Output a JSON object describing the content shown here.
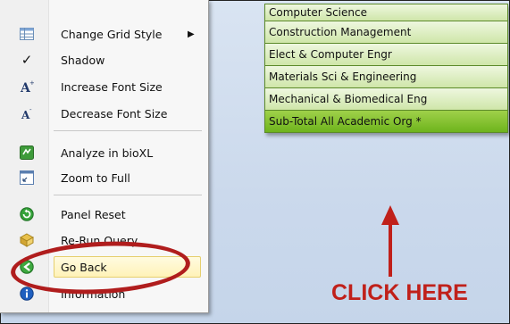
{
  "menu": {
    "items": [
      {
        "label": "Change Grid Style",
        "icon": "grid-style-icon",
        "has_submenu": true
      },
      {
        "label": "Shadow",
        "icon": "checkmark-icon",
        "checked": true
      },
      {
        "label": "Increase Font Size",
        "icon": "increase-font-icon"
      },
      {
        "label": "Decrease Font Size",
        "icon": "decrease-font-icon"
      },
      {
        "label": "Analyze in bioXL",
        "icon": "bioxl-icon"
      },
      {
        "label": "Zoom to Full",
        "icon": "zoom-full-icon"
      },
      {
        "label": "Panel Reset",
        "icon": "panel-reset-icon"
      },
      {
        "label": "Re-Run Query",
        "icon": "rerun-query-icon"
      },
      {
        "label": "Go Back",
        "icon": "go-back-icon",
        "highlighted": true
      },
      {
        "label": "Information",
        "icon": "information-icon"
      }
    ],
    "submenu_glyph": "▶",
    "check_glyph": "✓"
  },
  "grid": {
    "rows": [
      "Computer Science",
      "Construction Management",
      "Elect & Computer Engr",
      "Materials Sci & Engineering",
      "Mechanical & Biomedical Eng",
      "Sub-Total All Academic Org *"
    ]
  },
  "annotation": {
    "text": "CLICK HERE",
    "color": "#c0201a"
  }
}
